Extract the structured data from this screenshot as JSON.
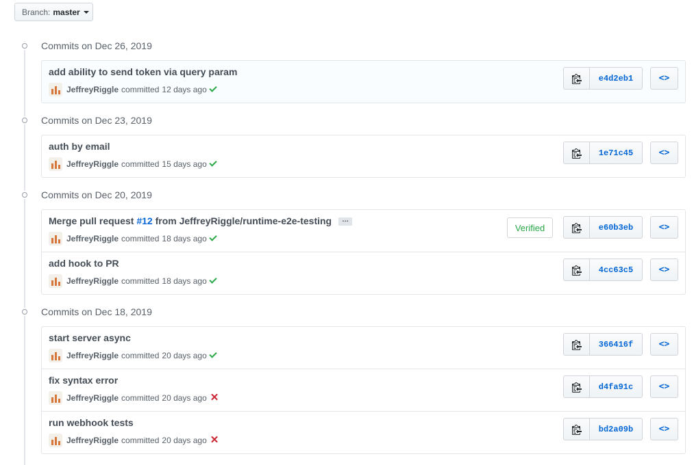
{
  "branch": {
    "label": "Branch:",
    "value": "master"
  },
  "groups": [
    {
      "title": "Commits on Dec 26, 2019",
      "commits": [
        {
          "message": "add ability to send token via query param",
          "author": "JeffreyRiggle",
          "action": "committed",
          "time": "12 days ago",
          "status": "success",
          "sha": "e4d2eb1"
        }
      ]
    },
    {
      "title": "Commits on Dec 23, 2019",
      "commits": [
        {
          "message": "auth by email",
          "author": "JeffreyRiggle",
          "action": "committed",
          "time": "15 days ago",
          "status": "success",
          "sha": "1e71c45"
        }
      ]
    },
    {
      "title": "Commits on Dec 20, 2019",
      "commits": [
        {
          "message_prefix": "Merge pull request ",
          "pr_link": "#12",
          "message_suffix": " from JeffreyRiggle/runtime-e2e-testing",
          "ellipsis": "…",
          "author": "JeffreyRiggle",
          "action": "committed",
          "time": "18 days ago",
          "status": "success",
          "verified": "Verified",
          "sha": "e60b3eb"
        },
        {
          "message": "add hook to PR",
          "author": "JeffreyRiggle",
          "action": "committed",
          "time": "18 days ago",
          "status": "success",
          "sha": "4cc63c5"
        }
      ]
    },
    {
      "title": "Commits on Dec 18, 2019",
      "commits": [
        {
          "message": "start server async",
          "author": "JeffreyRiggle",
          "action": "committed",
          "time": "20 days ago",
          "status": "success",
          "sha": "366416f"
        },
        {
          "message": "fix syntax error",
          "author": "JeffreyRiggle",
          "action": "committed",
          "time": "20 days ago",
          "status": "failure",
          "sha": "d4fa91c"
        },
        {
          "message": "run webhook tests",
          "author": "JeffreyRiggle",
          "action": "committed",
          "time": "20 days ago",
          "status": "failure",
          "sha": "bd2a09b"
        }
      ]
    }
  ],
  "icons": {
    "copy": "clipboard-icon",
    "browse": "code-icon",
    "node": "commit-node-icon",
    "success": "check-icon",
    "failure": "x-icon"
  },
  "colors": {
    "link": "#0366d6",
    "success": "#28a745",
    "failure": "#cb2431"
  }
}
